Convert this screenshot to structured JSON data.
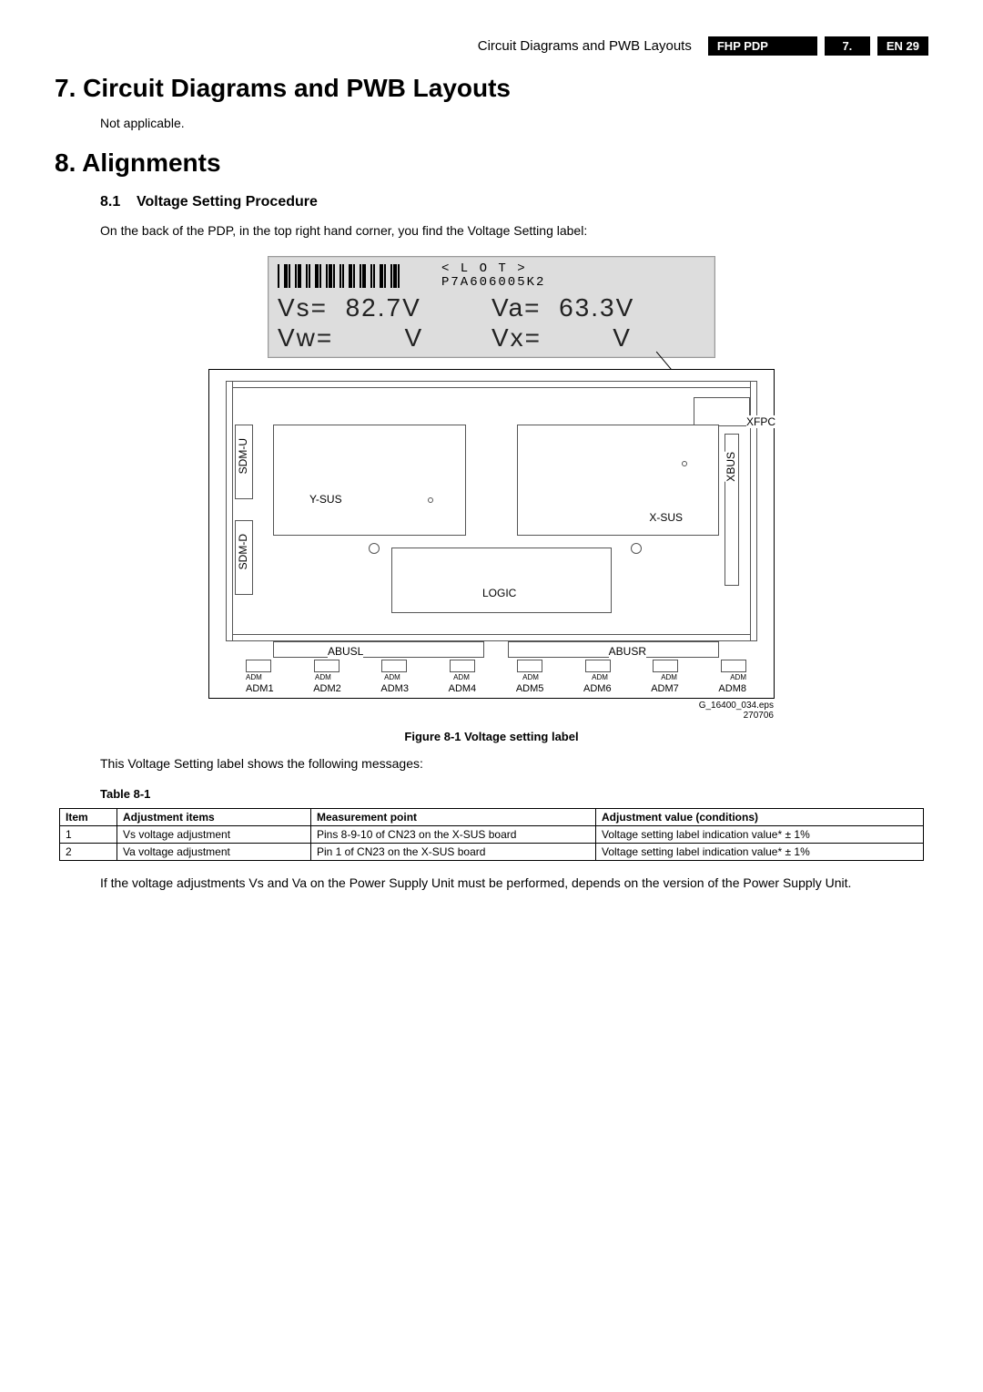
{
  "header": {
    "breadcrumb": "Circuit Diagrams and PWB Layouts",
    "model": "FHP PDP",
    "section_no": "7.",
    "page_code": "EN 29"
  },
  "sec7": {
    "title": "7.   Circuit Diagrams and PWB Layouts",
    "body": "Not applicable."
  },
  "sec8": {
    "title": "8.   Alignments",
    "sub_no": "8.1",
    "sub_title": "Voltage Setting Procedure",
    "intro": "On the back of the PDP, in the top right hand corner, you find the Voltage Setting label:"
  },
  "volt_label": {
    "lot_tag": "< L O T >",
    "lot_value": "P7A606005K2",
    "vs_key": "Vs=",
    "vs_val": "82.7V",
    "va_key": "Va=",
    "va_val": "63.3V",
    "vw_key": "Vw=",
    "vw_val": "V",
    "vx_key": "Vx=",
    "vx_val": "V"
  },
  "diagram": {
    "xfpc": "XFPC",
    "xbus": "XBUS",
    "sdmu": "SDM-U",
    "sdmd": "SDM-D",
    "ysus": "Y-SUS",
    "xsus": "X-SUS",
    "logic": "LOGIC",
    "abusl": "ABUSL",
    "abusr": "ABUSR",
    "adm_tiny": "ADM",
    "adm": [
      "ADM1",
      "ADM2",
      "ADM3",
      "ADM4",
      "ADM5",
      "ADM6",
      "ADM7",
      "ADM8"
    ],
    "eps": "G_16400_034.eps",
    "eps_date": "270706"
  },
  "fig_caption": "Figure 8-1 Voltage setting label",
  "after_fig": "This Voltage Setting label shows the following messages:",
  "table_caption": "Table 8-1",
  "table": {
    "headers": [
      "Item",
      "Adjustment items",
      "Measurement point",
      "Adjustment value (conditions)"
    ],
    "rows": [
      [
        "1",
        "Vs voltage adjustment",
        "Pins 8-9-10 of CN23 on the X-SUS board",
        "Voltage setting label indication value* ± 1%"
      ],
      [
        "2",
        "Va voltage adjustment",
        "Pin 1 of CN23 on the X-SUS board",
        "Voltage setting label indication value* ± 1%"
      ]
    ]
  },
  "footnote": "If the voltage adjustments Vs and Va on the Power Supply Unit must be performed, depends on the version of the Power Supply Unit."
}
